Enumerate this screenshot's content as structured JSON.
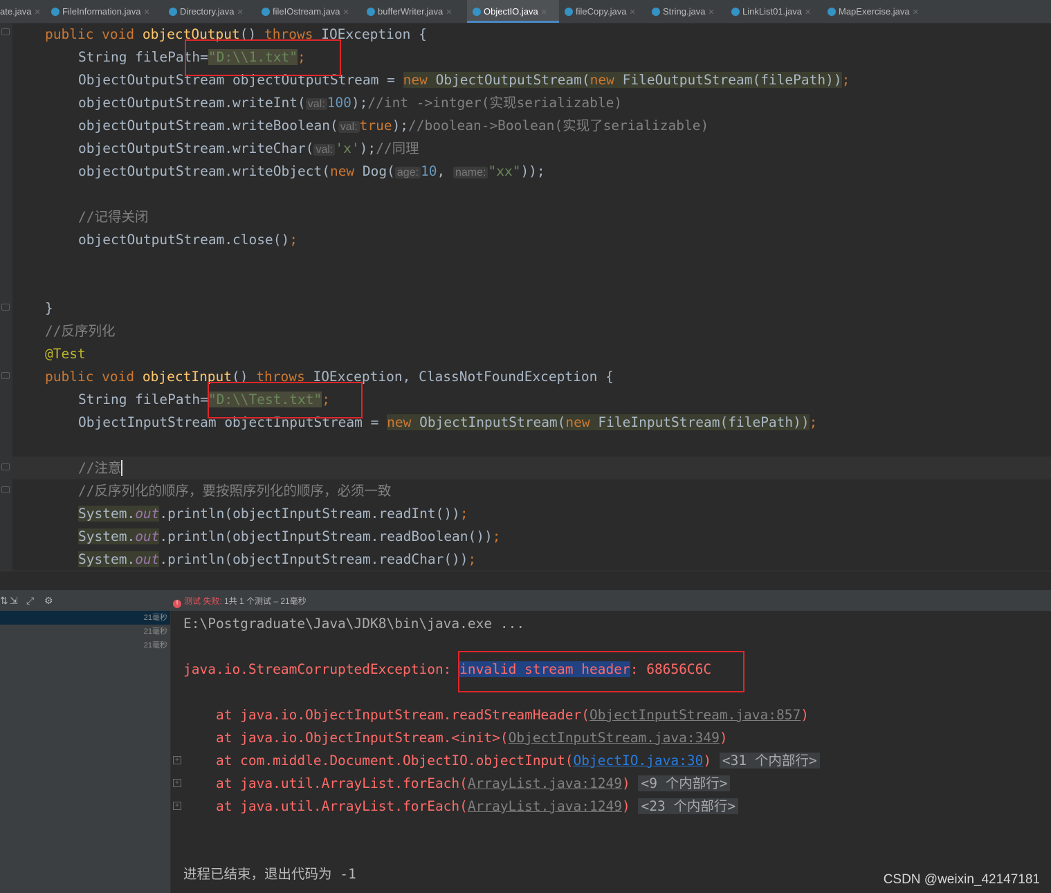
{
  "tabs": [
    {
      "label": "ate.java"
    },
    {
      "label": "FileInformation.java"
    },
    {
      "label": "Directory.java"
    },
    {
      "label": "fileIOstream.java"
    },
    {
      "label": "bufferWriter.java"
    },
    {
      "label": "ObjectIO.java",
      "active": true
    },
    {
      "label": "fileCopy.java"
    },
    {
      "label": "String.java"
    },
    {
      "label": "LinkList01.java"
    },
    {
      "label": "MapExercise.java"
    }
  ],
  "code": {
    "l1": {
      "kw1": "public void ",
      "fn": "objectOutput",
      "p": "() ",
      "kw2": "throws ",
      "rest": "IOException {"
    },
    "l2": {
      "pre": "String filePath=",
      "str": "\"D:\\\\1.txt\"",
      "semi": ";"
    },
    "l3": {
      "pre": "ObjectOutputStream objectOutputStream = ",
      "kw1": "new ",
      "mid": "ObjectOutputStream(",
      "kw2": "new ",
      "rest": "FileOutputStream(filePath))",
      "semi": ";"
    },
    "l4": {
      "pre": "objectOutputStream.writeInt(",
      "hint": "val:",
      "num": "100",
      "post": ");",
      "cmt": "//int ->intger(实现serializable)"
    },
    "l5": {
      "pre": "objectOutputStream.writeBoolean(",
      "hint": "val:",
      "val": "true",
      "post": ");",
      "cmt": "//boolean->Boolean(实现了serializable)"
    },
    "l6": {
      "pre": "objectOutputStream.writeChar(",
      "hint": "val:",
      "str": "'x'",
      "post": ");",
      "cmt": "//同理"
    },
    "l7": {
      "pre": "objectOutputStream.writeObject(",
      "kw": "new ",
      "cls": "Dog(",
      "hint1": "age:",
      "num": "10",
      "comma": ", ",
      "hint2": "name:",
      "str": "\"xx\"",
      "post": "));"
    },
    "l9": {
      "cmt": "//记得关闭"
    },
    "l10": {
      "pre": "objectOutputStream.close()",
      "semi": ";"
    },
    "l13": {
      "text": "}"
    },
    "l14": {
      "cmt": "//反序列化"
    },
    "l15": {
      "ann": "@Test"
    },
    "l16": {
      "kw1": "public void ",
      "fn": "objectInput",
      "p": "() ",
      "kw2": "throws ",
      "rest": "IOException, ClassNotFoundException {"
    },
    "l17": {
      "pre": "String filePath=",
      "str": "\"D:\\\\Test.txt\"",
      "semi": ";"
    },
    "l18": {
      "pre": "ObjectInputStream objectInputStream = ",
      "kw1": "new ",
      "mid": "ObjectInputStream(",
      "kw2": "new ",
      "rest": "FileInputStream(filePath))",
      "semi": ";"
    },
    "l20": {
      "cmt": "//注意"
    },
    "l21": {
      "cmt": "//反序列化的顺序，要按照序列化的顺序，必须一致"
    },
    "l22": {
      "sys": "System.",
      "out": "out",
      "rest": ".println(objectInputStream.readInt())",
      "semi": ";"
    },
    "l23": {
      "sys": "System.",
      "out": "out",
      "rest": ".println(objectInputStream.readBoolean())",
      "semi": ";"
    },
    "l24": {
      "sys": "System.",
      "out": "out",
      "rest": ".println(objectInputStream.readChar())",
      "semi": ";"
    }
  },
  "run": {
    "status_fail": "测试 失败:",
    "status_rest": " 1共 1 个测试 – 21毫秒",
    "tree_times": [
      "21毫秒",
      "21毫秒",
      "21毫秒"
    ]
  },
  "console": {
    "c1": "E:\\Postgraduate\\Java\\JDK8\\bin\\java.exe ...",
    "c2": {
      "exc": "java.io.StreamCorruptedException: ",
      "sel": "invalid stream header",
      "rest": ": 68656C6C"
    },
    "c3": {
      "at": "    at java.io.ObjectInputStream.readStreamHeader(",
      "link": "ObjectInputStream.java:857",
      "end": ")"
    },
    "c4": {
      "at": "    at java.io.ObjectInputStream.<init>(",
      "link": "ObjectInputStream.java:349",
      "end": ")"
    },
    "c5": {
      "at": "    at com.middle.Document.ObjectIO.objectInput(",
      "link": "ObjectIO.java:30",
      "end": ")",
      "fold": "<31 个内部行>"
    },
    "c6": {
      "at": "    at java.util.ArrayList.forEach(",
      "link": "ArrayList.java:1249",
      "end": ")",
      "fold": "<9 个内部行>"
    },
    "c7": {
      "at": "    at java.util.ArrayList.forEach(",
      "link": "ArrayList.java:1249",
      "end": ")",
      "fold": "<23 个内部行>"
    },
    "c8": "进程已结束，退出代码为 -1"
  },
  "watermark": "CSDN @weixin_42147181",
  "colors": {
    "keyword": "#cc7832",
    "string": "#6a8759",
    "number": "#6897bb",
    "comment": "#808080",
    "error": "#ff6b68",
    "highlight_box": "#e0262a"
  }
}
